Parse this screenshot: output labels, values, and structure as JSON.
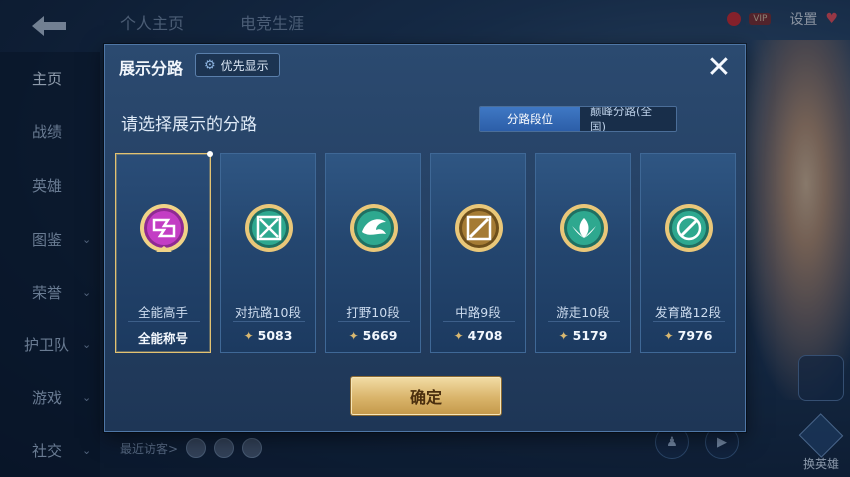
{
  "top_tabs": [
    "个人主页",
    "电竞生涯"
  ],
  "sidebar": {
    "items": [
      {
        "label": "主页",
        "chev": ""
      },
      {
        "label": "战绩",
        "chev": ""
      },
      {
        "label": "英雄",
        "chev": ""
      },
      {
        "label": "图鉴",
        "chev": "⌄"
      },
      {
        "label": "荣誉",
        "chev": "⌄"
      },
      {
        "label": "护卫队",
        "chev": "⌄"
      },
      {
        "label": "游戏",
        "chev": "⌄"
      },
      {
        "label": "社交",
        "chev": "⌄"
      }
    ]
  },
  "topbar": {
    "vip_label": "VIP",
    "settings_label": "设置",
    "icons": [
      "vip-badge",
      "heart-icon"
    ]
  },
  "visitors": {
    "label": "最近访客>"
  },
  "right_panel": {
    "change_hero_label": "换英雄"
  },
  "modal": {
    "title": "展示分路",
    "priority_label": "优先显示",
    "close_label": "✕",
    "subtitle": "请选择展示的分路",
    "toggle": {
      "options": [
        "分路段位",
        "巅峰分路(全国)"
      ],
      "active": "分路段位"
    },
    "cards": [
      {
        "name": "全能高手",
        "footer": "全能称号",
        "points": "",
        "color": "#b02fb8",
        "icon": "all-round-icon",
        "selected": true
      },
      {
        "name": "对抗路10段",
        "footer": "",
        "points": "5083",
        "color": "#2f9e86",
        "icon": "clash-lane-icon",
        "selected": false
      },
      {
        "name": "打野10段",
        "footer": "",
        "points": "5669",
        "color": "#2f9e86",
        "icon": "jungle-icon",
        "selected": false
      },
      {
        "name": "中路9段",
        "footer": "",
        "points": "4708",
        "color": "#8a6a2e",
        "icon": "mid-lane-icon",
        "selected": false
      },
      {
        "name": "游走10段",
        "footer": "",
        "points": "5179",
        "color": "#2f9e86",
        "icon": "roam-icon",
        "selected": false
      },
      {
        "name": "发育路12段",
        "footer": "",
        "points": "7976",
        "color": "#2f9e86",
        "icon": "farm-lane-icon",
        "selected": false
      }
    ],
    "confirm_label": "确定"
  },
  "colors": {
    "accent_gold": "#d9b46a",
    "toggle_active": "#3f78c4",
    "selected_border": "#e3c271"
  }
}
